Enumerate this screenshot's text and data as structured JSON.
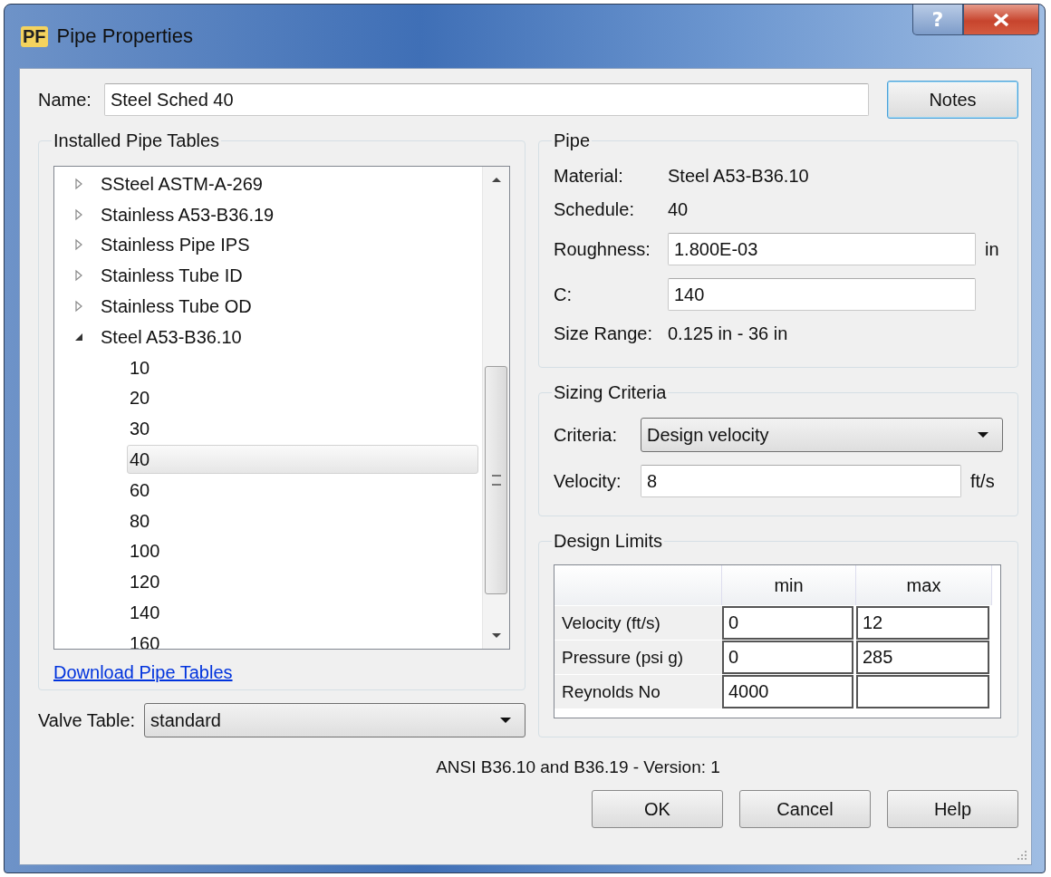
{
  "window": {
    "logo": "PF",
    "title": "Pipe Properties",
    "help": "?"
  },
  "name": {
    "label": "Name:",
    "value": "Steel Sched 40"
  },
  "notes_button": "Notes",
  "installed": {
    "title": "Installed Pipe Tables",
    "tree": [
      {
        "label": "SSteel ASTM-A-269",
        "expanded": false,
        "selected": false
      },
      {
        "label": "Stainless A53-B36.19",
        "expanded": false,
        "selected": false
      },
      {
        "label": "Stainless Pipe IPS",
        "expanded": false,
        "selected": false
      },
      {
        "label": "Stainless Tube ID",
        "expanded": false,
        "selected": false
      },
      {
        "label": "Stainless Tube OD",
        "expanded": false,
        "selected": false
      },
      {
        "label": "Steel A53-B36.10",
        "expanded": true,
        "selected": false,
        "children": [
          {
            "label": "10",
            "selected": false
          },
          {
            "label": "20",
            "selected": false
          },
          {
            "label": "30",
            "selected": false
          },
          {
            "label": "40",
            "selected": true
          },
          {
            "label": "60",
            "selected": false
          },
          {
            "label": "80",
            "selected": false
          },
          {
            "label": "100",
            "selected": false
          },
          {
            "label": "120",
            "selected": false
          },
          {
            "label": "140",
            "selected": false
          },
          {
            "label": "160",
            "selected": false
          }
        ]
      }
    ],
    "link": "Download Pipe Tables"
  },
  "valve_table": {
    "label": "Valve Table:",
    "value": "standard"
  },
  "pipe": {
    "title": "Pipe",
    "material": {
      "label": "Material:",
      "value": "Steel A53-B36.10"
    },
    "schedule": {
      "label": "Schedule:",
      "value": "40"
    },
    "roughness": {
      "label": "Roughness:",
      "value": "1.800E-03",
      "unit": "in"
    },
    "c": {
      "label": "C:",
      "value": "140"
    },
    "size_range": {
      "label": "Size Range:",
      "value": "0.125 in - 36 in"
    }
  },
  "sizing": {
    "title": "Sizing Criteria",
    "criteria": {
      "label": "Criteria:",
      "value": "Design velocity"
    },
    "velocity": {
      "label": "Velocity:",
      "value": "8",
      "unit": "ft/s"
    }
  },
  "limits": {
    "title": "Design Limits",
    "columns": [
      "min",
      "max"
    ],
    "rows": [
      {
        "label": "Velocity (ft/s)",
        "min": "0",
        "max": "12"
      },
      {
        "label": "Pressure (psi g)",
        "min": "0",
        "max": "285"
      },
      {
        "label": "Reynolds No",
        "min": "4000"
      }
    ]
  },
  "version": "ANSI B36.10 and B36.19 - Version: 1",
  "buttons": [
    "OK",
    "Cancel",
    "Help"
  ]
}
